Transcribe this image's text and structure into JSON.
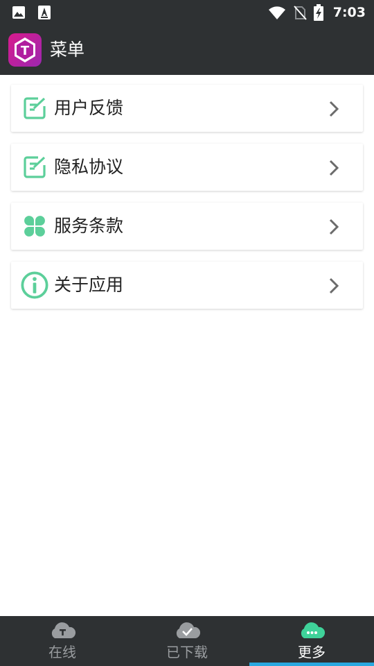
{
  "status_bar": {
    "time": "7:03",
    "left_icons": [
      "image-icon",
      "font-app-icon"
    ],
    "right_icons": [
      "wifi-icon",
      "no-sim-icon",
      "battery-charging-icon"
    ]
  },
  "app_bar": {
    "logo_letter": "T",
    "title": "菜单"
  },
  "menu": {
    "items": [
      {
        "label": "用户反馈",
        "icon": "edit-note-icon"
      },
      {
        "label": "隐私协议",
        "icon": "edit-note-icon"
      },
      {
        "label": "服务条款",
        "icon": "clover-icon"
      },
      {
        "label": "关于应用",
        "icon": "info-icon"
      }
    ]
  },
  "tabs": [
    {
      "label": "在线",
      "icon": "cloud-t-icon",
      "active": false
    },
    {
      "label": "已下载",
      "icon": "cloud-check-icon",
      "active": false
    },
    {
      "label": "更多",
      "icon": "cloud-more-icon",
      "active": true
    }
  ],
  "colors": {
    "bar_background": "#2e3133",
    "accent_green": "#5ccf9a",
    "tab_active_indicator": "#29a8e0",
    "tab_inactive": "#9a9da0",
    "logo_gradient_start": "#d81b8c",
    "logo_gradient_end": "#9c27b0"
  }
}
